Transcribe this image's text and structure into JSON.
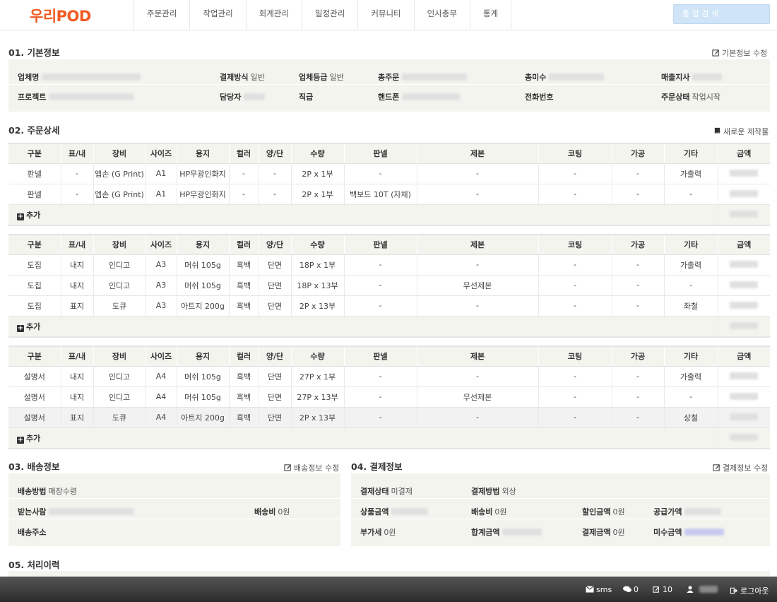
{
  "header": {
    "logo": "우리POD",
    "nav": [
      "주문관리",
      "작업관리",
      "회계관리",
      "일정관리",
      "커뮤니티",
      "인사총무",
      "통계"
    ],
    "search_placeholder": "통 합 검 색"
  },
  "basic": {
    "title": "01. 기본정보",
    "edit": "기본정보 수정",
    "company_label": "업체명",
    "payment_label": "결제방식",
    "payment_value": "일반",
    "grade_label": "업체등급",
    "grade_value": "일반",
    "total_order_label": "총주문",
    "total_unpaid_label": "총미수",
    "branch_label": "매출지사",
    "project_label": "프로젝트",
    "manager_label": "담당자",
    "position_label": "직급",
    "mobile_label": "핸드폰",
    "phone_label": "전화번호",
    "status_label": "주문상태",
    "status_value": "작업시작"
  },
  "detail": {
    "title": "02. 주문상세",
    "new_action": "새로운 제작물",
    "columns": [
      "구분",
      "표/내",
      "장비",
      "사이즈",
      "용지",
      "컬러",
      "양/단",
      "수량",
      "판넬",
      "제본",
      "코팅",
      "가공",
      "기타",
      "금액"
    ],
    "add_label": "추가",
    "groups": [
      {
        "rows": [
          [
            "판넬",
            "-",
            "엡손 (G Print)",
            "A1",
            "HP무광인화지",
            "-",
            "-",
            "2P x 1부",
            "-",
            "-",
            "-",
            "-",
            "가출력"
          ],
          [
            "판넬",
            "-",
            "엡손 (G Print)",
            "A1",
            "HP무광인화지",
            "-",
            "-",
            "2P x 1부",
            "백보드 10T (자체)",
            "-",
            "-",
            "-",
            "-"
          ]
        ]
      },
      {
        "rows": [
          [
            "도집",
            "내지",
            "인디고",
            "A3",
            "머쉬 105g",
            "흑백",
            "단면",
            "18P x 1부",
            "-",
            "-",
            "-",
            "-",
            "가출력"
          ],
          [
            "도집",
            "내지",
            "인디고",
            "A3",
            "머쉬 105g",
            "흑백",
            "단면",
            "18P x 13부",
            "-",
            "무선제본",
            "-",
            "-",
            "-"
          ],
          [
            "도집",
            "표지",
            "도큐",
            "A3",
            "아트지 200g",
            "흑백",
            "단면",
            "2P x 13부",
            "-",
            "-",
            "-",
            "-",
            "좌철"
          ]
        ]
      },
      {
        "rows": [
          [
            "설명서",
            "내지",
            "인디고",
            "A4",
            "머쉬 105g",
            "흑백",
            "단면",
            "27P x 1부",
            "-",
            "-",
            "-",
            "-",
            "가출력"
          ],
          [
            "설명서",
            "내지",
            "인디고",
            "A4",
            "머쉬 105g",
            "흑백",
            "단면",
            "27P x 13부",
            "-",
            "무선제본",
            "-",
            "-",
            "-"
          ],
          [
            "설명서",
            "표지",
            "도큐",
            "A4",
            "아트지 200g",
            "흑백",
            "단면",
            "2P x 13부",
            "-",
            "-",
            "-",
            "-",
            "상철"
          ]
        ]
      }
    ]
  },
  "shipping": {
    "title": "03. 배송정보",
    "edit": "배송정보 수정",
    "method_label": "배송방법",
    "method_value": "매장수령",
    "receiver_label": "받는사람",
    "fee_label": "배송비",
    "fee_value": "0원",
    "address_label": "배송주소"
  },
  "payment": {
    "title": "04. 결제정보",
    "edit": "결제정보 수정",
    "state_label": "결제상태",
    "state_value": "미결제",
    "method_label": "결제방법",
    "method_value": "외상",
    "goods_label": "상품금액",
    "ship_label": "배송비",
    "ship_value": "0원",
    "discount_label": "할인금액",
    "discount_value": "0원",
    "supply_label": "공급가액",
    "vat_label": "부가세",
    "vat_value": "0원",
    "sum_label": "합계금액",
    "paid_label": "결제금액",
    "paid_value": "0원",
    "unpaid_label": "미수금액"
  },
  "history": {
    "title": "05. 처리이력"
  },
  "footer": {
    "sms": "sms",
    "messages": "0",
    "notes": "10",
    "logout": "로그아웃"
  },
  "colors": {
    "logo": "#f15a22",
    "panel": "#f4f4ef",
    "search": "#cfe5f7"
  }
}
